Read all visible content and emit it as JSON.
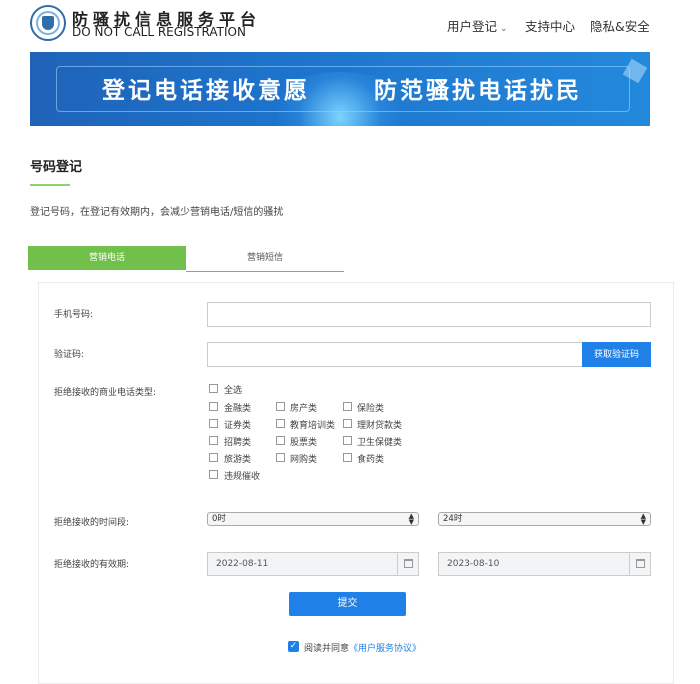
{
  "header": {
    "brand_cn": "防骚扰信息服务平台",
    "brand_en": "DO NOT CALL REGISTRATION",
    "nav": [
      {
        "label": "用户登记",
        "has_dropdown": true
      },
      {
        "label": "支持中心",
        "has_dropdown": false
      },
      {
        "label": "隐私&安全",
        "has_dropdown": false
      }
    ]
  },
  "banner": {
    "slogan_left": "登记电话接收意愿",
    "slogan_right": "防范骚扰电话扰民"
  },
  "section": {
    "title": "号码登记",
    "description": "登记号码，在登记有效期内，会减少营销电话/短信的骚扰"
  },
  "tabs": [
    {
      "label": "营销电话",
      "active": true
    },
    {
      "label": "营销短信",
      "active": false
    }
  ],
  "form": {
    "phone_label": "手机号码:",
    "phone_value": "",
    "code_label": "验证码:",
    "code_value": "",
    "code_button": "获取验证码",
    "types_label": "拒绝接收的商业电话类型:",
    "select_all": "全选",
    "types": [
      [
        "金融类",
        "房产类",
        "保险类"
      ],
      [
        "证券类",
        "教育培训类",
        "理财贷款类"
      ],
      [
        "招聘类",
        "股票类",
        "卫生保健类"
      ],
      [
        "旅游类",
        "网购类",
        "食药类"
      ],
      [
        "违规催收"
      ]
    ],
    "time_label": "拒绝接收的时间段:",
    "time_start": "0时",
    "time_end": "24时",
    "period_label": "拒绝接收的有效期:",
    "date_start": "2022-08-11",
    "date_end": "2023-08-10",
    "submit": "提交",
    "agree_prefix": "阅读并同意",
    "agree_link": "《用户服务协议》"
  },
  "colors": {
    "primary": "#1f80e8",
    "tab_green": "#72c04c",
    "banner_blue": "#1d73cc"
  }
}
